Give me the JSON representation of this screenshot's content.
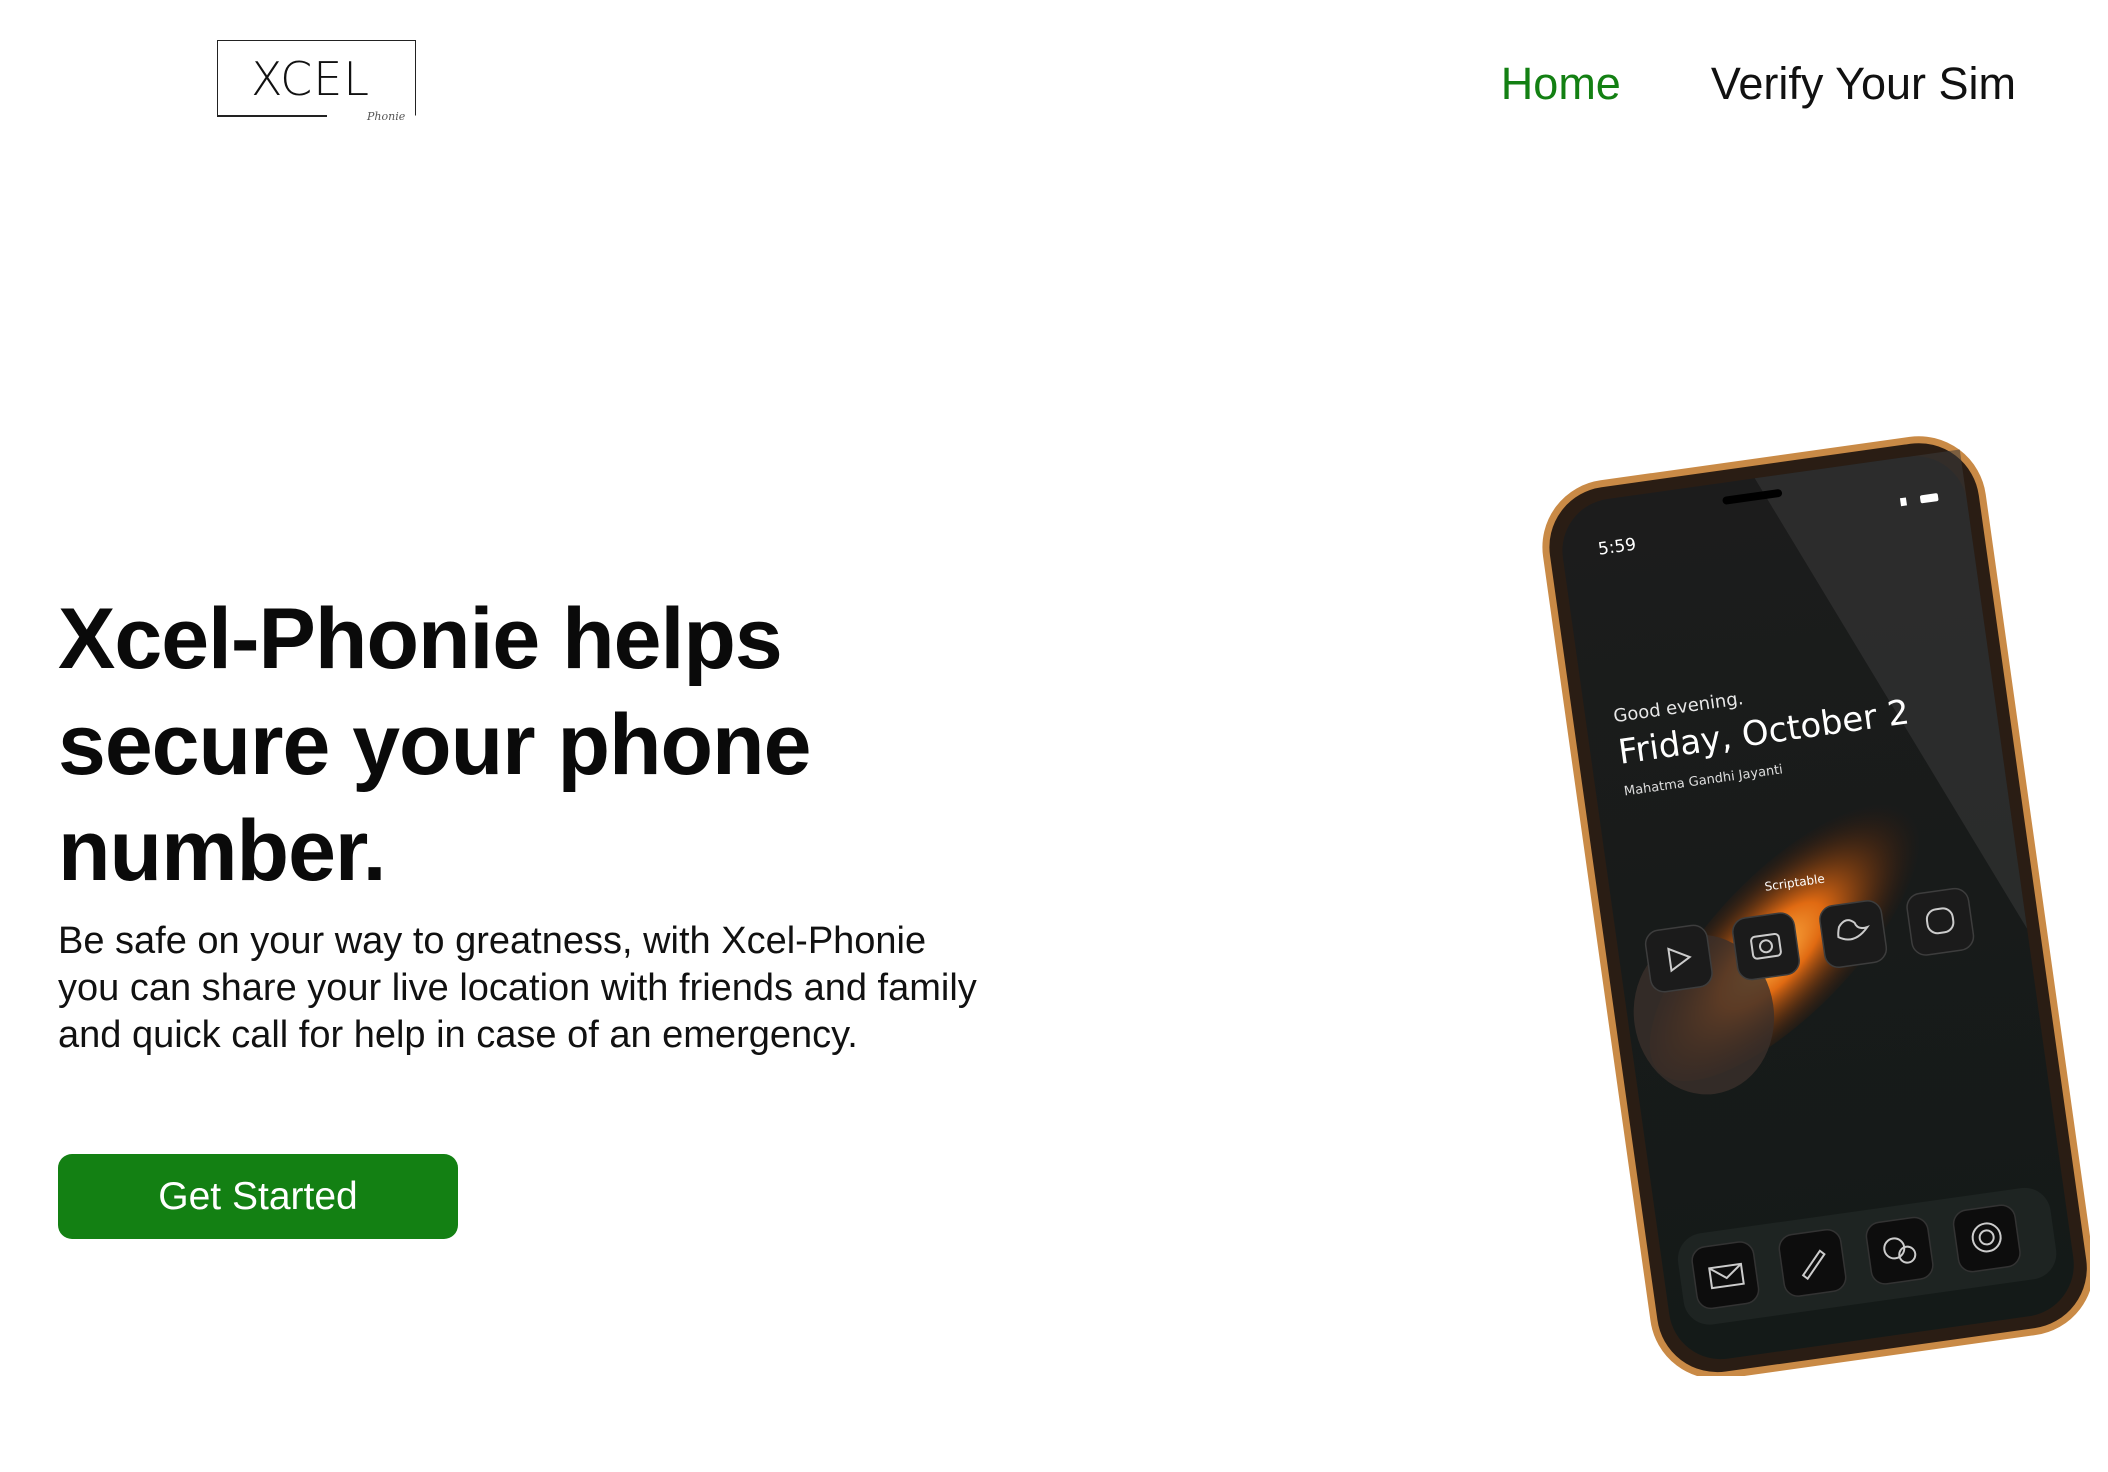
{
  "logo": {
    "text": "XCEL",
    "sub": "Phonie"
  },
  "nav": {
    "items": [
      {
        "label": "Home",
        "active": true
      },
      {
        "label": "Verify Your Sim",
        "active": false
      }
    ]
  },
  "hero": {
    "title": "Xcel-Phonie helps secure your phone number.",
    "description": "Be safe on your way to greatness, with Xcel-Phonie you can share your live location with friends and family and quick call for help in case of an emergency.",
    "cta_label": "Get Started"
  },
  "phone_screen": {
    "time": "5:59",
    "greeting": "Good evening.",
    "date": "Friday, October 2",
    "holiday": "Mahatma Gandhi Jayanti",
    "widget_label": "Scriptable"
  },
  "colors": {
    "accent": "#138013",
    "text": "#111111",
    "background": "#ffffff"
  },
  "icons": [
    "play-icon",
    "camera-icon",
    "twitter-icon",
    "chat-icon",
    "mail-icon",
    "pen-icon",
    "messages-icon",
    "contactless-icon"
  ]
}
